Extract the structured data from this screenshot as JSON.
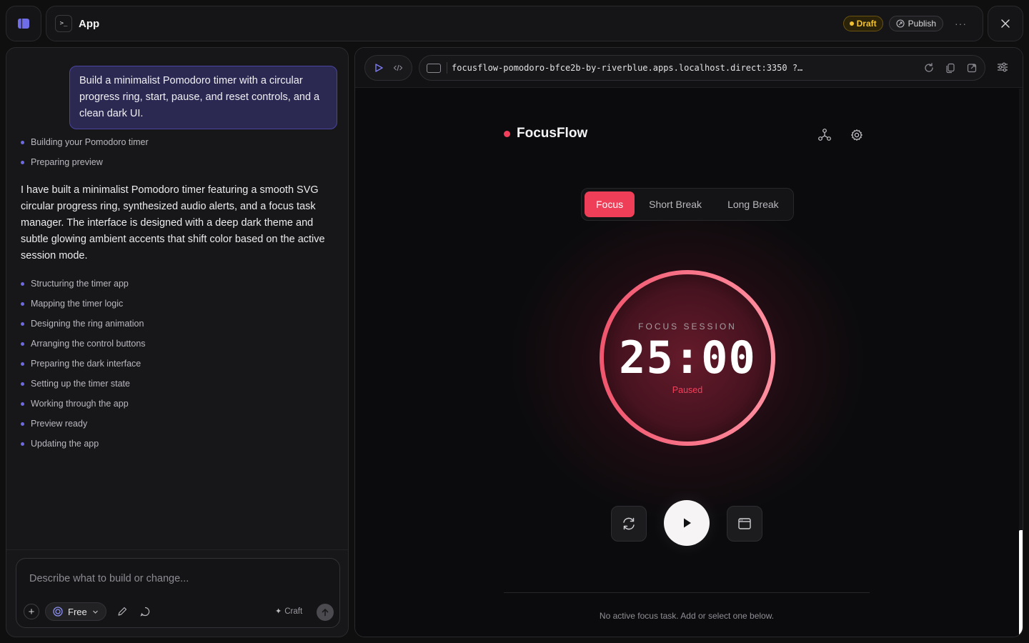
{
  "topbar": {
    "app_title": "App",
    "draft_label": "Draft",
    "publish_label": "Publish",
    "more_label": "···"
  },
  "chat": {
    "user_message": "Build a minimalist Pomodoro timer with a circular progress ring, start, pause, and reset controls, and a clean dark UI.",
    "steps_before": [
      "Building your Pomodoro timer",
      "Preparing preview"
    ],
    "assistant_message": "I have built a minimalist Pomodoro timer featuring a smooth SVG circular progress ring, synthesized audio alerts, and a focus task manager. The interface is designed with a deep dark theme and subtle glowing ambient accents that shift color based on the active session mode.",
    "steps_after": [
      "Structuring the timer app",
      "Mapping the timer logic",
      "Designing the ring animation",
      "Arranging the control buttons",
      "Preparing the dark interface",
      "Setting up the timer state",
      "Working through the app",
      "Preview ready",
      "Updating the app"
    ],
    "composer": {
      "placeholder": "Describe what to build or change...",
      "model_label": "Free",
      "craft_label": "Craft"
    }
  },
  "preview": {
    "url": "focusflow-pomodoro-bfce2b-by-riverblue.apps.localhost.direct:3350 ?…",
    "app": {
      "brand": "FocusFlow",
      "tabs": [
        {
          "label": "Focus",
          "active": true
        },
        {
          "label": "Short Break",
          "active": false
        },
        {
          "label": "Long Break",
          "active": false
        }
      ],
      "session_label": "FOCUS SESSION",
      "time": "25:00",
      "status": "Paused",
      "ring_progress": 1.0,
      "task_empty": "No active focus task. Add or select one below."
    }
  },
  "colors": {
    "accent": "#ef3f58",
    "bubble": "#2b2952",
    "draft": "#f2c230"
  }
}
